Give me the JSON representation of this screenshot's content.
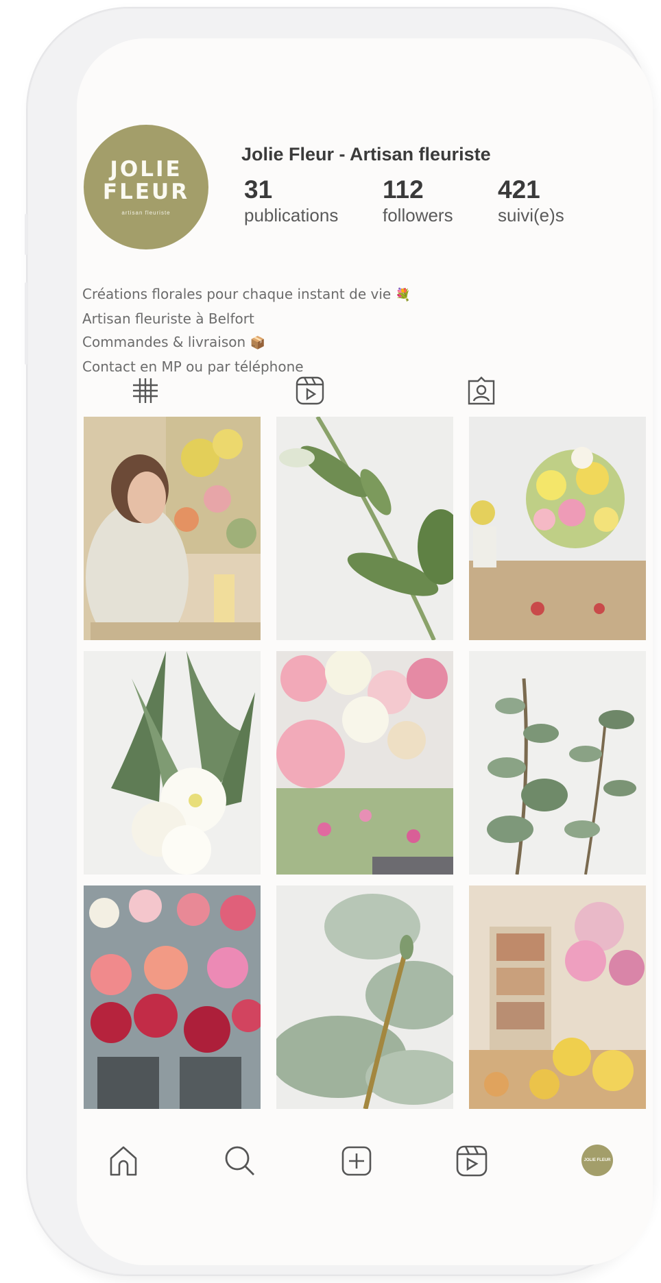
{
  "profile": {
    "logo_line1": "JOLIE",
    "logo_line2": "FLEUR",
    "logo_tagline": "artisan fleuriste",
    "name": "Jolie Fleur - Artisan fleuriste",
    "stats": [
      {
        "value": "31",
        "label": "publications"
      },
      {
        "value": "112",
        "label": "followers"
      },
      {
        "value": "421",
        "label": "suivi(e)s"
      }
    ],
    "bio": [
      "Créations florales pour chaque instant de vie",
      "Artisan fleuriste à Belfort",
      "Commandes & livraison",
      "Contact en MP ou par téléphone"
    ]
  },
  "colors": {
    "brand": "#a39e6a",
    "background": "#fcfbfa",
    "text": "#3b3b3b"
  },
  "tabs": [
    {
      "icon": "grid-icon"
    },
    {
      "icon": "reels-icon"
    },
    {
      "icon": "tagged-icon"
    }
  ],
  "posts": [
    "woman-florist-shop",
    "green-stem-leaves",
    "bouquet-workbench",
    "white-tulips",
    "pink-rose-bouquet",
    "eucalyptus-branch",
    "red-dahlias-buckets",
    "eucalyptus-leaf-closeup",
    "flower-shop-interior"
  ],
  "nav": [
    {
      "icon": "home-icon"
    },
    {
      "icon": "search-icon"
    },
    {
      "icon": "add-post-icon"
    },
    {
      "icon": "reels-icon"
    },
    {
      "icon": "profile-avatar-icon",
      "text": "JOLIE FLEUR"
    }
  ]
}
